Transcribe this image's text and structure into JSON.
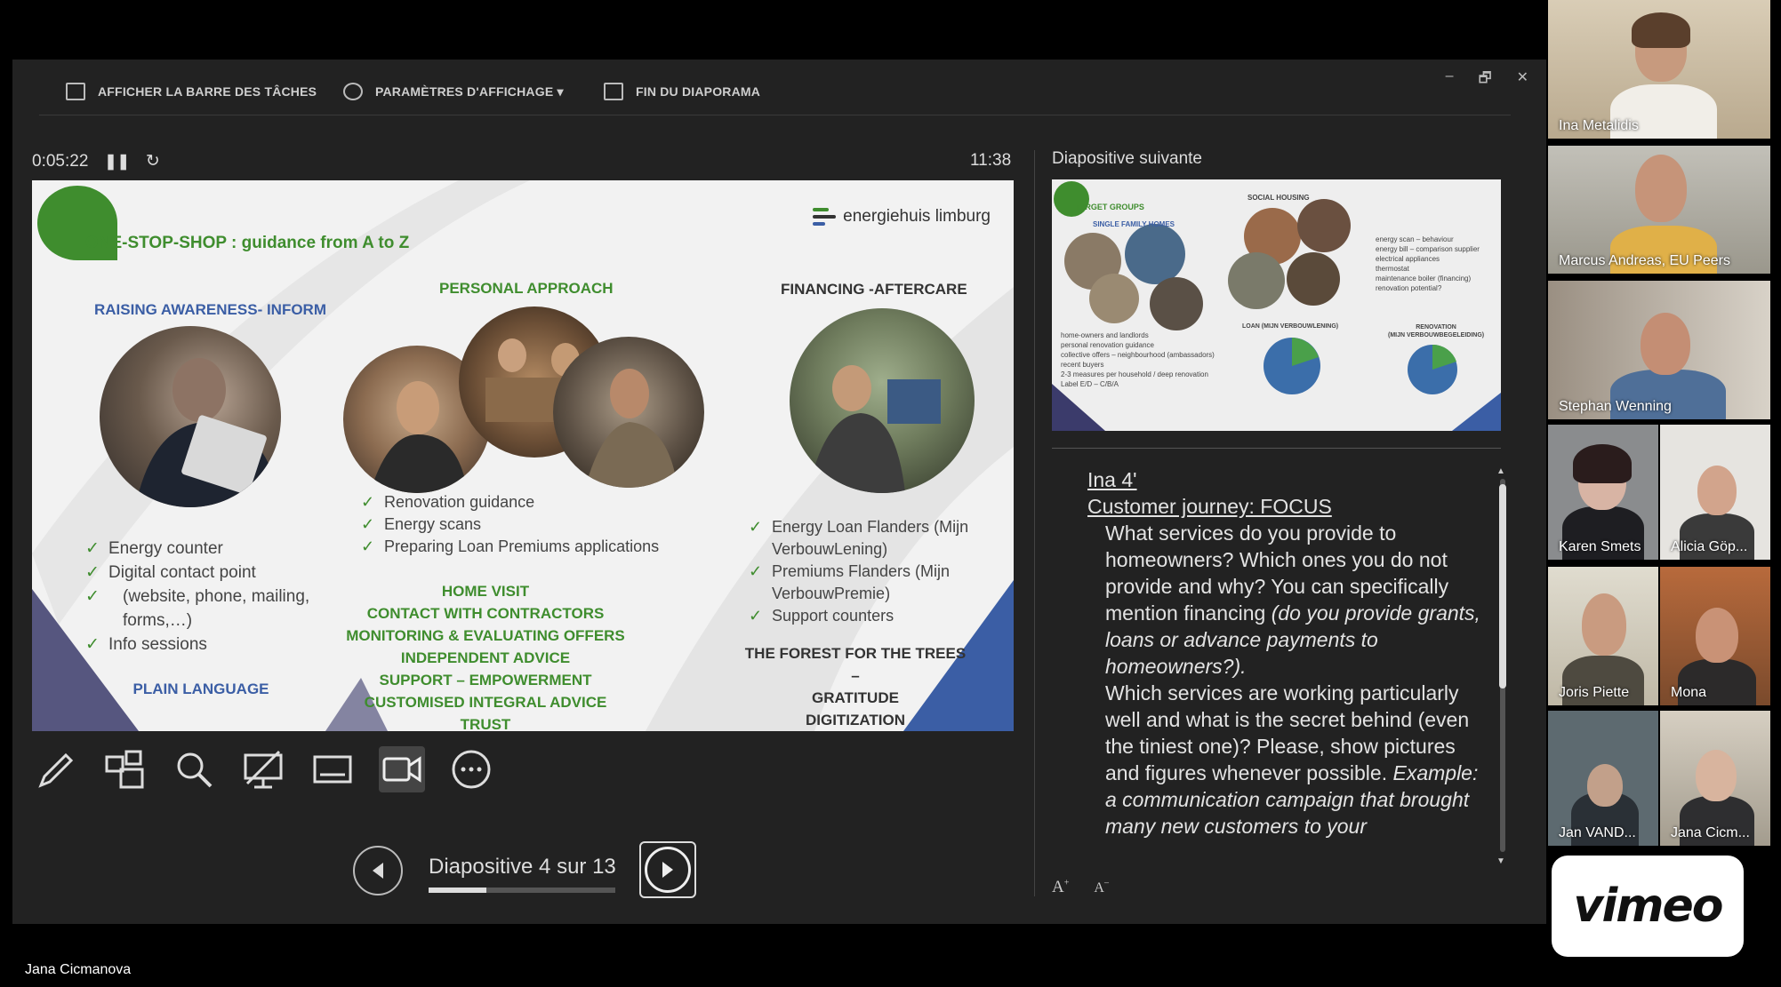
{
  "toolbar": {
    "taskbar": "AFFICHER LA BARRE DES TÂCHES",
    "display_settings": "PARAMÈTRES D'AFFICHAGE ▾",
    "end_show": "FIN DU DIAPORAMA"
  },
  "window_controls": {
    "minimize": "–",
    "restore": "🗗",
    "close": "✕"
  },
  "presenter": {
    "elapsed": "0:05:22",
    "clock": "11:38",
    "counter": "Diapositive 4 sur 13",
    "progress": 0.31,
    "next_label": "Diapositive suivante"
  },
  "slide": {
    "title": "ONE-STOP-SHOP : guidance from A to Z",
    "brand": "energiehuis limburg",
    "col1": {
      "head": "RAISING AWARENESS- INFORM",
      "bullets": [
        "Energy counter",
        "Digital contact point",
        "(website, phone, mailing, forms,…)",
        "Info sessions"
      ],
      "footer": "PLAIN LANGUAGE"
    },
    "col2": {
      "head": "PERSONAL APPROACH",
      "bullets": [
        "Renovation guidance",
        "Energy scans",
        "Preparing Loan Premiums applications"
      ],
      "caps": [
        "HOME VISIT",
        "CONTACT WITH CONTRACTORS",
        "MONITORING & EVALUATING OFFERS",
        "INDEPENDENT ADVICE",
        "SUPPORT – EMPOWERMENT",
        "CUSTOMISED INTEGRAL ADVICE",
        "TRUST"
      ]
    },
    "col3": {
      "head": "FINANCING -AFTERCARE",
      "bullets": [
        "Energy Loan Flanders (Mijn VerbouwLening)",
        "Premiums Flanders (Mijn VerbouwPremie)",
        "Support counters"
      ],
      "caps": [
        "THE FOREST FOR THE TREES –",
        "GRATITUDE",
        "DIGITIZATION"
      ]
    }
  },
  "next_slide": {
    "target_groups": "TARGET GROUPS",
    "single_family": "SINGLE FAMILY HOMES",
    "social_housing": "SOCIAL HOUSING",
    "list_left": [
      "home-owners and landlords",
      "personal renovation guidance",
      "collective offers – neighbourhood (ambassadors)",
      "recent buyers",
      "2-3 measures per household / deep renovation",
      "Label E/D – C/B/A"
    ],
    "list_right": [
      "energy scan – behaviour",
      "energy bill – comparison supplier",
      "electrical appliances",
      "thermostat",
      "maintenance boiler (financing)",
      "renovation potential?"
    ],
    "loan": "LOAN (MIJN VERBOUWLENING)",
    "renovation": "RENOVATION",
    "renovation_sub": "(MIJN VERBOUWBEGELEIDING)"
  },
  "notes": {
    "line1": "Ina 4'",
    "line2": "Customer journey: FOCUS",
    "b1_plain": "What services do you provide to homeowners? Which ones you do not provide and why? You can specifically mention financing ",
    "b1_italic": "(do you provide grants, loans or advance payments to homeowners?).",
    "b2_plain": "Which services are working particularly well and what is the secret behind (even the tiniest one)? Please, show pictures and figures whenever possible. ",
    "b2_italic": "Example: a communication campaign that brought many new customers to your"
  },
  "font_buttons": {
    "increase": "A",
    "decrease": "A"
  },
  "participants": [
    {
      "name": "Ina Metalidis"
    },
    {
      "name": "Marcus Andreas, EU Peers"
    },
    {
      "name": "Stephan Wenning"
    },
    {
      "name": "Karen Smets"
    },
    {
      "name": "Alicia Göp..."
    },
    {
      "name": "Joris Piette"
    },
    {
      "name": "Mona"
    },
    {
      "name": "Jan VAND..."
    },
    {
      "name": "Jana Cicm..."
    }
  ],
  "vimeo_logo": "vimeo",
  "bottom_name": "Jana Cicmanova",
  "colors": {
    "slide_green": "#3f8d2e",
    "slide_blue": "#3b5ea5",
    "bg": "#222222"
  }
}
